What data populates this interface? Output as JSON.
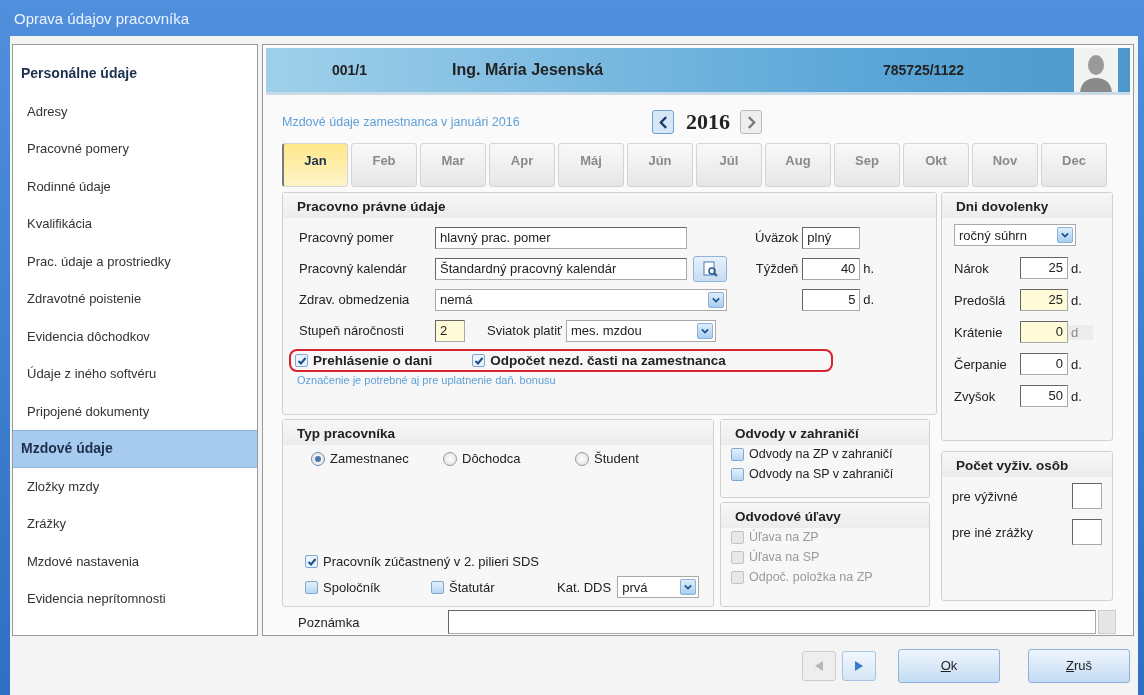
{
  "window": {
    "title": "Oprava údajov pracovníka"
  },
  "sidebar": {
    "items": [
      {
        "label": "Personálne údaje",
        "kind": "group",
        "selected": false
      },
      {
        "label": "Adresy",
        "kind": "item",
        "selected": false
      },
      {
        "label": "Pracovné pomery",
        "kind": "item",
        "selected": false
      },
      {
        "label": "Rodinné údaje",
        "kind": "item",
        "selected": false
      },
      {
        "label": "Kvalifikácia",
        "kind": "item",
        "selected": false
      },
      {
        "label": "Prac. údaje a prostriedky",
        "kind": "item",
        "selected": false
      },
      {
        "label": "Zdravotné poistenie",
        "kind": "item",
        "selected": false
      },
      {
        "label": "Evidencia dôchodkov",
        "kind": "item",
        "selected": false
      },
      {
        "label": "Údaje z iného softvéru",
        "kind": "item",
        "selected": false
      },
      {
        "label": "Pripojené dokumenty",
        "kind": "item",
        "selected": false
      },
      {
        "label": "Mzdové údaje",
        "kind": "group",
        "selected": true
      },
      {
        "label": "Zložky mzdy",
        "kind": "item",
        "selected": false
      },
      {
        "label": "Zrážky",
        "kind": "item",
        "selected": false
      },
      {
        "label": "Mzdové nastavenia",
        "kind": "item",
        "selected": false
      },
      {
        "label": "Evidencia neprítomnosti",
        "kind": "item",
        "selected": false
      }
    ]
  },
  "employee": {
    "number": "001/1",
    "name": "Ing. Mária Jesenská",
    "id_number": "785725/1122"
  },
  "period": {
    "caption": "Mzdové údaje zamestnanca v januári 2016",
    "year": "2016",
    "nav": [
      {
        "kind": "prev",
        "highlighted": true
      },
      {
        "kind": "next",
        "highlighted": false
      }
    ]
  },
  "months": [
    {
      "label": "Jan",
      "selected": true
    },
    {
      "label": "Feb",
      "selected": false
    },
    {
      "label": "Mar",
      "selected": false
    },
    {
      "label": "Apr",
      "selected": false
    },
    {
      "label": "Máj",
      "selected": false
    },
    {
      "label": "Jún",
      "selected": false
    },
    {
      "label": "Júl",
      "selected": false
    },
    {
      "label": "Aug",
      "selected": false
    },
    {
      "label": "Sep",
      "selected": false
    },
    {
      "label": "Okt",
      "selected": false
    },
    {
      "label": "Nov",
      "selected": false
    },
    {
      "label": "Dec",
      "selected": false
    }
  ],
  "work": {
    "title": "Pracovno právne údaje",
    "employment": {
      "label": "Pracovný pomer",
      "value": "hlavný prac. pomer"
    },
    "calendar": {
      "label": "Pracovný kalendár",
      "value": "Štandardný pracovný kalendár"
    },
    "health": {
      "label": "Zdrav. obmedzenia",
      "value": "nemá"
    },
    "difficulty": {
      "label": "Stupeň náročnosti",
      "value": "2"
    },
    "holiday": {
      "label": "Sviatok platiť",
      "value": "mes. mzdou"
    },
    "workload": {
      "label": "Úväzok",
      "value": "plný"
    },
    "week_hours": {
      "label": "Týždeň",
      "value": "40",
      "unit": "h."
    },
    "week_days": {
      "value": "5",
      "unit": "d."
    },
    "tax_checks": {
      "highlighted": true,
      "items": [
        {
          "label": "Prehlásenie o dani",
          "checked": true
        },
        {
          "label": "Odpočet nezd. časti na zamestnanca",
          "checked": true
        }
      ]
    },
    "hint": "Označenie je potrebné aj pre uplatnenie daň. bonusu"
  },
  "vacation": {
    "title": "Dni dovolenky",
    "mode": "ročný súhrn",
    "rows": [
      {
        "label": "Nárok",
        "value": "25",
        "unit": "d.",
        "highlighted": false,
        "unit_disabled": false
      },
      {
        "label": "Predošlá",
        "value": "25",
        "unit": "d.",
        "highlighted": true,
        "unit_disabled": false
      },
      {
        "label": "Krátenie",
        "value": "0",
        "unit": "d",
        "highlighted": true,
        "unit_disabled": true
      },
      {
        "label": "Čerpanie",
        "value": "0",
        "unit": "d.",
        "highlighted": false,
        "unit_disabled": false
      },
      {
        "label": "Zvyšok",
        "value": "50",
        "unit": "d.",
        "highlighted": false,
        "unit_disabled": false
      }
    ]
  },
  "worker_type": {
    "title": "Typ pracovníka",
    "options": [
      {
        "label": "Zamestnanec",
        "selected": true
      },
      {
        "label": "Dôchodca",
        "selected": false
      },
      {
        "label": "Študent",
        "selected": false
      }
    ],
    "pillar": {
      "label": "Pracovník zúčastnený v 2. pilieri SDS",
      "checked": true
    },
    "flags": [
      {
        "label": "Spoločník",
        "checked": false
      },
      {
        "label": "Štatutár",
        "checked": false
      }
    ],
    "dds": {
      "label": "Kat. DDS",
      "value": "prvá"
    }
  },
  "foreign": {
    "title": "Odvody v zahraničí",
    "items": [
      {
        "label": "Odvody na ZP v zahraničí",
        "checked": false,
        "disabled": false
      },
      {
        "label": "Odvody na SP v zahraničí",
        "checked": false,
        "disabled": false
      }
    ]
  },
  "relief": {
    "title": "Odvodové úľavy",
    "items": [
      {
        "label": "Úľava na ZP",
        "checked": false,
        "disabled": true
      },
      {
        "label": "Úľava na SP",
        "checked": false,
        "disabled": true
      },
      {
        "label": "Odpoč. položka na ZP",
        "checked": false,
        "disabled": true
      }
    ]
  },
  "dependents": {
    "title": "Počet vyživ. osôb",
    "rows": [
      {
        "label": "pre výživné"
      },
      {
        "label": "pre iné zrážky"
      }
    ]
  },
  "note": {
    "label": "Poznámka"
  },
  "footer": {
    "nav": [
      {
        "kind": "prev",
        "disabled": true
      },
      {
        "kind": "next",
        "disabled": false
      }
    ],
    "buttons": [
      {
        "label": "Ok"
      },
      {
        "label": "Zruš"
      }
    ]
  }
}
